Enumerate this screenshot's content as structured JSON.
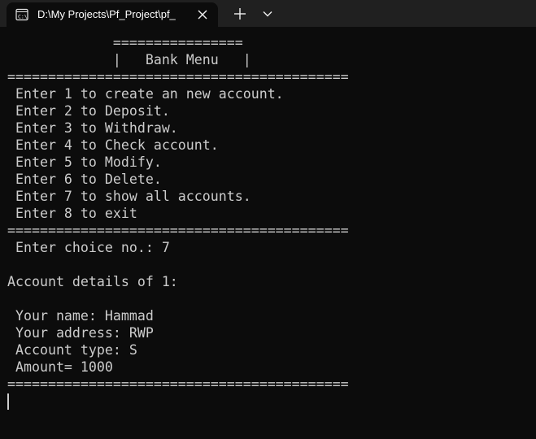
{
  "window": {
    "tab_title": "D:\\My Projects\\Pf_Project\\pf_",
    "icons": {
      "tab": "terminal-icon",
      "close": "close-icon",
      "new_tab": "plus-icon",
      "dropdown": "chevron-down-icon"
    },
    "colors": {
      "tabbar_bg": "#202020",
      "terminal_bg": "#0c0c0c",
      "text": "#cccccc"
    }
  },
  "terminal": {
    "lines": [
      "             ================",
      "             |   Bank Menu   |",
      "==========================================",
      " Enter 1 to create an new account.",
      " Enter 2 to Deposit.",
      " Enter 3 to Withdraw.",
      " Enter 4 to Check account.",
      " Enter 5 to Modify.",
      " Enter 6 to Delete.",
      " Enter 7 to show all accounts.",
      " Enter 8 to exit",
      "==========================================",
      " Enter choice no.: 7",
      "",
      "Account details of 1:",
      "",
      " Your name: Hammad",
      " Your address: RWP",
      " Account type: S",
      " Amount= 1000",
      "=========================================="
    ]
  }
}
